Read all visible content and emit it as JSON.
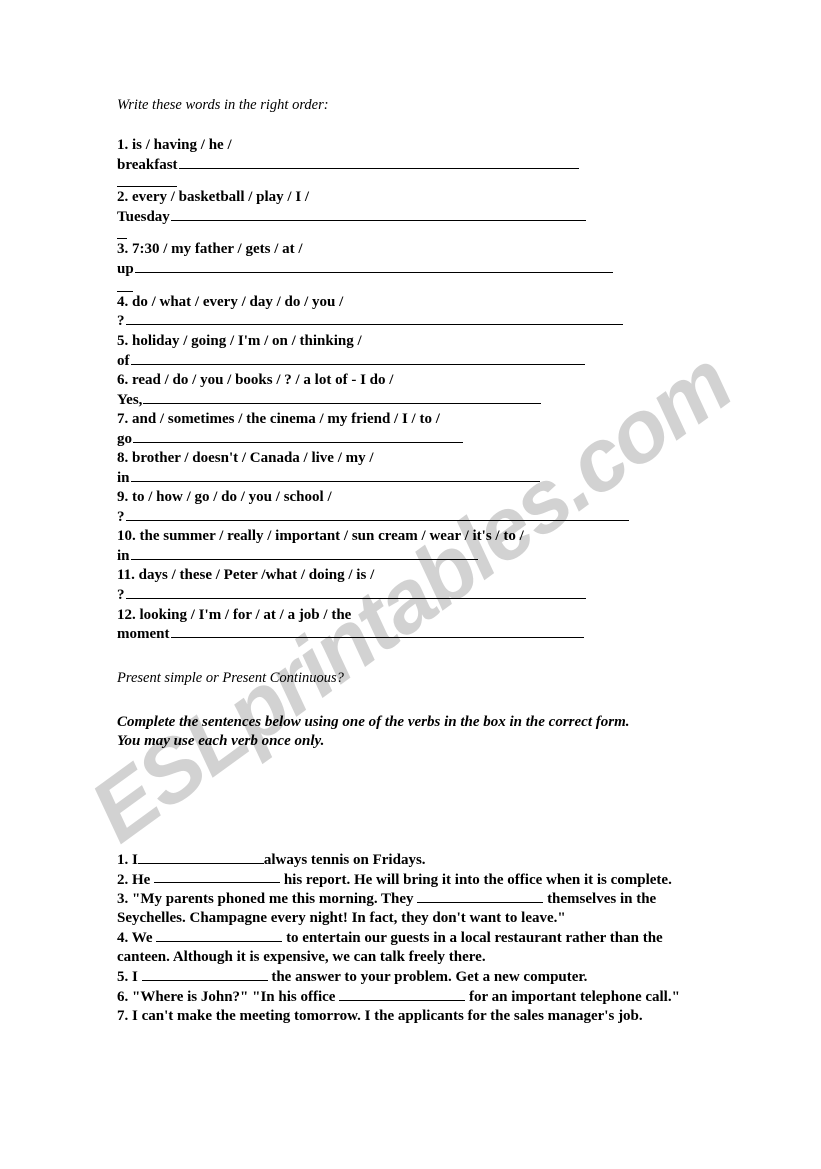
{
  "watermark": {
    "text": "ESLprintables.com",
    "color": "#d2d2d2"
  },
  "section_one": {
    "instruction": "Write these words in the right order:",
    "items": [
      {
        "number": "1.",
        "words": "1. is / having / he /",
        "lead": "breakfast",
        "rule_width": 400
      },
      {
        "number": "2.",
        "words": "2. every / basketball / play / I /",
        "lead": "Tuesday",
        "rule_width": 415
      },
      {
        "number": "3.",
        "words": "3. 7:30 / my father / gets / at /",
        "lead": "up",
        "rule_width": 478
      },
      {
        "number": "4.",
        "words": "4. do / what / every / day / do / you /",
        "lead": "?",
        "rule_width": 497
      },
      {
        "number": "5.",
        "words": "5. holiday / going / I'm / on / thinking /",
        "lead": "of",
        "rule_width": 454
      },
      {
        "number": "6.",
        "words": "6. read / do / you / books / ? / a lot of - I do /",
        "lead": "Yes,",
        "rule_width": 398
      },
      {
        "number": "7.",
        "words": "7. and / sometimes / the cinema / my friend / I / to /",
        "lead": "go",
        "rule_width": 330
      },
      {
        "number": "8.",
        "words": "8. brother / doesn't / Canada / live / my /",
        "lead": "in",
        "rule_width": 409
      },
      {
        "number": "9.",
        "words": "9. to / how / go / do / you / school /",
        "lead": "?",
        "rule_width": 503
      },
      {
        "number": "10.",
        "words": "10. the summer / really / important / sun cream / wear / it's / to /",
        "lead": "in",
        "rule_width": 347
      },
      {
        "number": "11.",
        "words": "11. days / these / Peter /what / doing / is /",
        "lead": "?",
        "rule_width": 460
      },
      {
        "number": "12.",
        "words": "12. looking / I'm / for / at / a job / the",
        "lead": "moment",
        "rule_width": 413
      }
    ]
  },
  "section_two": {
    "heading": "Present simple or Present Continuous?",
    "instruction_line1": "Complete the sentences below using one of the verbs in the box in the correct form.",
    "instruction_line2": "You may use each verb once only.",
    "sentences": [
      {
        "number": "1.",
        "before": "1. I",
        "blank_width": 126,
        "after": "always tennis on Fridays."
      },
      {
        "number": "2.",
        "before": "2. He ",
        "blank_width": 126,
        "after": " his report. He will bring it into the office when it is complete."
      },
      {
        "number": "3.",
        "before": "3. \"My parents phoned me this morning. They ",
        "blank_width": 126,
        "after": " themselves in the Seychelles. Champagne every night! In fact, they don't want to leave.\""
      },
      {
        "number": "4.",
        "before": "4. We ",
        "blank_width": 126,
        "after": " to entertain our guests in a local restaurant rather than the canteen. Although it is expensive, we can talk freely there."
      },
      {
        "number": "5.",
        "before": "5. I ",
        "blank_width": 126,
        "after": " the answer to your problem. Get a new computer."
      },
      {
        "number": "6.",
        "before": "6. \"Where is John?\" \"In his office ",
        "blank_width": 126,
        "after": " for an important telephone call.\""
      },
      {
        "number": "7.",
        "before": "7. I can't make the meeting tomorrow. I the applicants for the sales manager's job.",
        "blank_width": 0,
        "after": ""
      }
    ]
  }
}
